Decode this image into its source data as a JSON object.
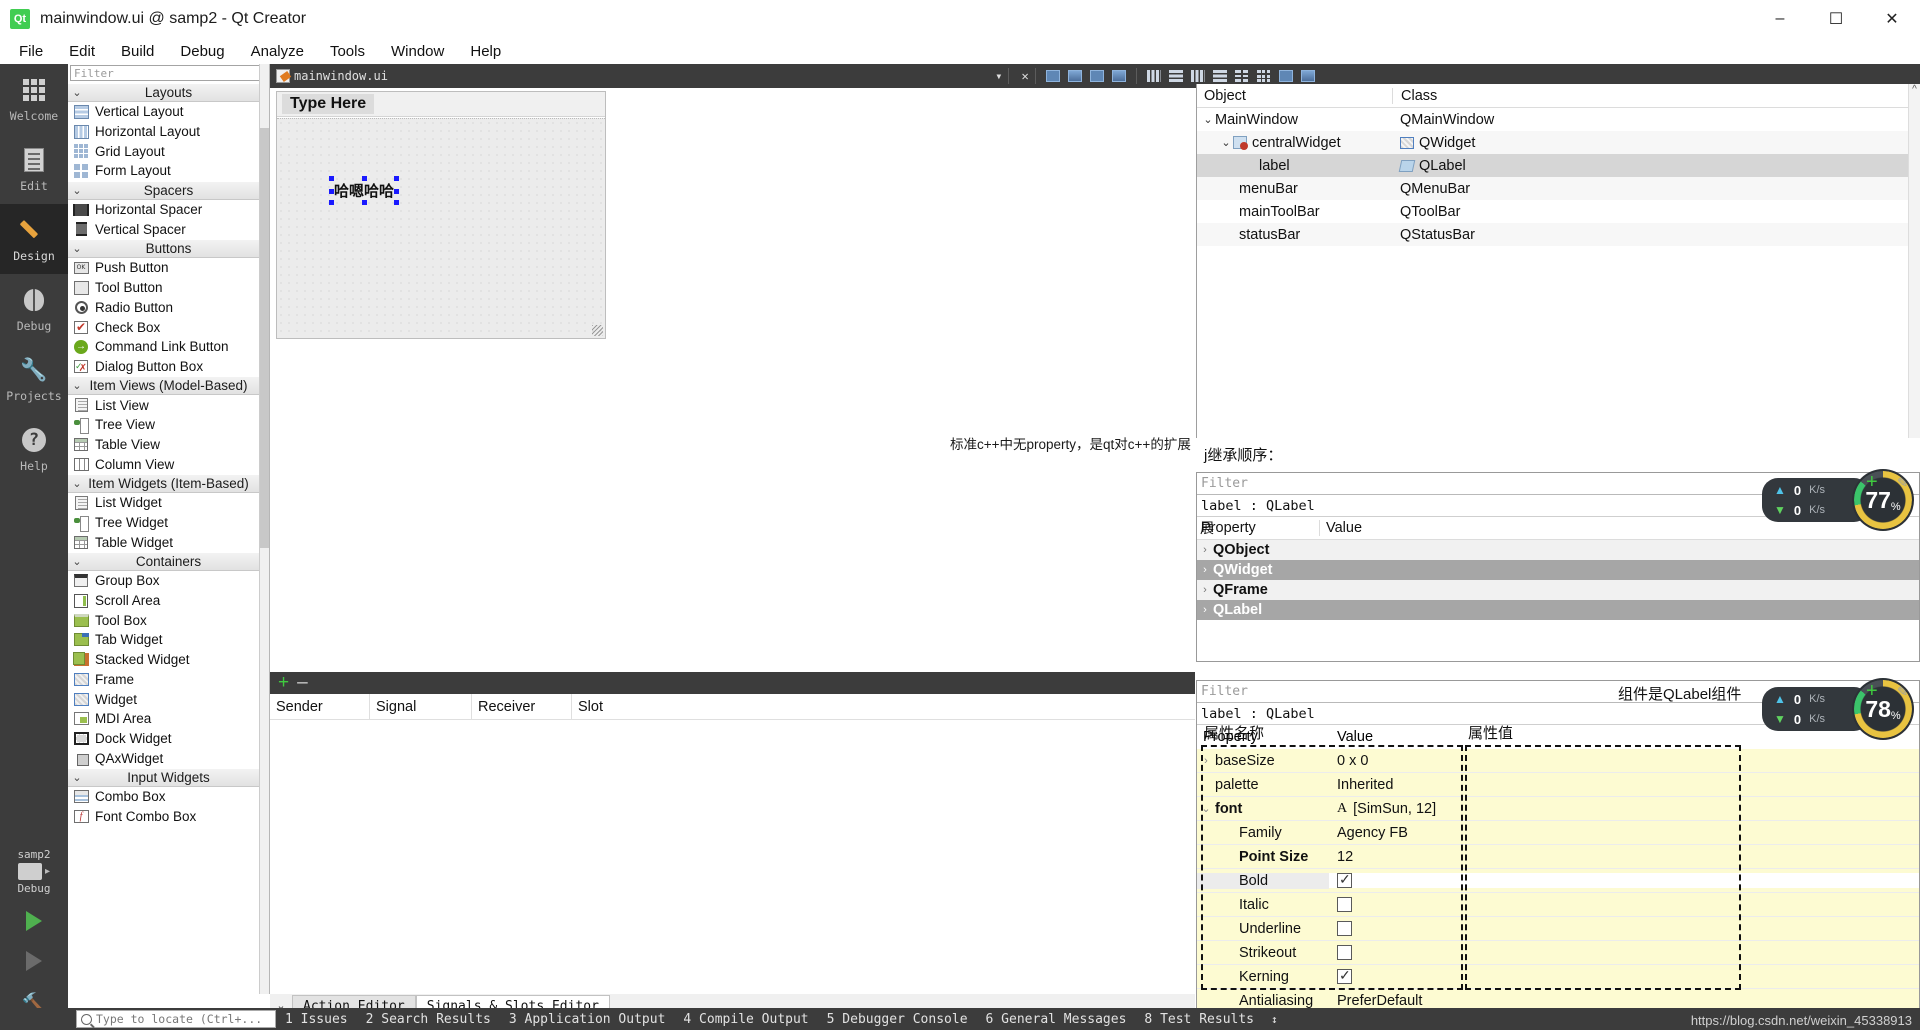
{
  "window": {
    "title": "mainwindow.ui @ samp2 - Qt Creator",
    "logo_text": "Qt",
    "minimize": "–",
    "maximize": "☐",
    "close": "✕"
  },
  "menubar": [
    {
      "label": "File"
    },
    {
      "label": "Edit"
    },
    {
      "label": "Build"
    },
    {
      "label": "Debug"
    },
    {
      "label": "Analyze"
    },
    {
      "label": "Tools"
    },
    {
      "label": "Window"
    },
    {
      "label": "Help"
    }
  ],
  "modebar": {
    "items": [
      {
        "label": "Welcome",
        "icon": "grid-icon"
      },
      {
        "label": "Edit",
        "icon": "document-icon"
      },
      {
        "label": "Design",
        "icon": "pencil-icon"
      },
      {
        "label": "Debug",
        "icon": "bug-icon"
      },
      {
        "label": "Projects",
        "icon": "wrench-icon"
      },
      {
        "label": "Help",
        "icon": "question-icon"
      }
    ],
    "kit_name": "samp2",
    "kit_mode": "Debug"
  },
  "editor_toolbar": {
    "file_name": "mainwindow.ui",
    "dropdown": "▾",
    "close": "✕"
  },
  "widget_box": {
    "filter_placeholder": "Filter",
    "categories": [
      {
        "name": "Layouts",
        "items": [
          {
            "label": "Vertical Layout",
            "icon": "vertical-layout-icon"
          },
          {
            "label": "Horizontal Layout",
            "icon": "horizontal-layout-icon"
          },
          {
            "label": "Grid Layout",
            "icon": "grid-layout-icon"
          },
          {
            "label": "Form Layout",
            "icon": "form-layout-icon"
          }
        ]
      },
      {
        "name": "Spacers",
        "items": [
          {
            "label": "Horizontal Spacer",
            "icon": "horizontal-spacer-icon"
          },
          {
            "label": "Vertical Spacer",
            "icon": "vertical-spacer-icon"
          }
        ]
      },
      {
        "name": "Buttons",
        "items": [
          {
            "label": "Push Button",
            "icon": "push-button-icon"
          },
          {
            "label": "Tool Button",
            "icon": "tool-button-icon"
          },
          {
            "label": "Radio Button",
            "icon": "radio-button-icon"
          },
          {
            "label": "Check Box",
            "icon": "check-box-icon"
          },
          {
            "label": "Command Link Button",
            "icon": "command-link-icon"
          },
          {
            "label": "Dialog Button Box",
            "icon": "dialog-button-box-icon"
          }
        ]
      },
      {
        "name": "Item Views (Model-Based)",
        "items": [
          {
            "label": "List View",
            "icon": "list-view-icon"
          },
          {
            "label": "Tree View",
            "icon": "tree-view-icon"
          },
          {
            "label": "Table View",
            "icon": "table-view-icon"
          },
          {
            "label": "Column View",
            "icon": "column-view-icon"
          }
        ]
      },
      {
        "name": "Item Widgets (Item-Based)",
        "items": [
          {
            "label": "List Widget",
            "icon": "list-widget-icon"
          },
          {
            "label": "Tree Widget",
            "icon": "tree-widget-icon"
          },
          {
            "label": "Table Widget",
            "icon": "table-widget-icon"
          }
        ]
      },
      {
        "name": "Containers",
        "items": [
          {
            "label": "Group Box",
            "icon": "group-box-icon"
          },
          {
            "label": "Scroll Area",
            "icon": "scroll-area-icon"
          },
          {
            "label": "Tool Box",
            "icon": "tool-box-icon"
          },
          {
            "label": "Tab Widget",
            "icon": "tab-widget-icon"
          },
          {
            "label": "Stacked Widget",
            "icon": "stacked-widget-icon"
          },
          {
            "label": "Frame",
            "icon": "frame-icon"
          },
          {
            "label": "Widget",
            "icon": "widget-icon"
          },
          {
            "label": "MDI Area",
            "icon": "mdi-area-icon"
          },
          {
            "label": "Dock Widget",
            "icon": "dock-widget-icon"
          },
          {
            "label": "QAxWidget",
            "icon": "qax-widget-icon"
          }
        ]
      },
      {
        "name": "Input Widgets",
        "items": [
          {
            "label": "Combo Box",
            "icon": "combo-box-icon"
          },
          {
            "label": "Font Combo Box",
            "icon": "font-combo-box-icon"
          }
        ]
      }
    ]
  },
  "canvas": {
    "type_here": "Type Here",
    "label_text": "哈嗯哈哈",
    "annotation": "标准c++中无property，是qt对c++的扩展"
  },
  "object_tree": {
    "columns": [
      "Object",
      "Class"
    ],
    "rows": [
      {
        "object": "MainWindow",
        "class": "QMainWindow",
        "indent": 0,
        "chevron": "⌄",
        "icon": "",
        "selected": false
      },
      {
        "object": "centralWidget",
        "class": "QWidget",
        "indent": 1,
        "chevron": "⌄",
        "icon": "central-widget-icon",
        "class_icon": "widget-icon",
        "selected": false
      },
      {
        "object": "label",
        "class": "QLabel",
        "indent": 2,
        "chevron": "",
        "icon": "",
        "class_icon": "label-icon",
        "selected": true
      },
      {
        "object": "menuBar",
        "class": "QMenuBar",
        "indent": 1,
        "chevron": "",
        "icon": "",
        "selected": false
      },
      {
        "object": "mainToolBar",
        "class": "QToolBar",
        "indent": 1,
        "chevron": "",
        "icon": "",
        "selected": false
      },
      {
        "object": "statusBar",
        "class": "QStatusBar",
        "indent": 1,
        "chevron": "",
        "icon": "",
        "selected": false
      }
    ]
  },
  "inheritance_note": "j继承顺序：",
  "expand_note": "展",
  "property_editor_upper": {
    "filter_placeholder": "Filter",
    "object_line": "label : QLabel",
    "columns": [
      "Property",
      "Value"
    ],
    "rows": [
      {
        "name": "QObject",
        "style": "light"
      },
      {
        "name": "QWidget",
        "style": "dark"
      },
      {
        "name": "QFrame",
        "style": "light"
      },
      {
        "name": "QLabel",
        "style": "dark"
      }
    ]
  },
  "property_editor_lower": {
    "filter_placeholder": "Filter",
    "object_line": "label : QLabel",
    "note": "组件是QLabel组件",
    "col_note_name": "属性名称",
    "col_note_value": "属性值",
    "columns": [
      "Property",
      "Value"
    ],
    "rows": [
      {
        "name": "baseSize",
        "value": "0 x 0",
        "kind": "text",
        "chevron": "›",
        "indent": 1,
        "bold": false
      },
      {
        "name": "palette",
        "value": "Inherited",
        "kind": "text",
        "chevron": "",
        "indent": 1,
        "bold": false
      },
      {
        "name": "font",
        "value": "[SimSun, 12]",
        "kind": "font",
        "chevron": "⌄",
        "indent": 1,
        "bold": true
      },
      {
        "name": "Family",
        "value": "Agency FB",
        "kind": "text",
        "chevron": "",
        "indent": 2,
        "bold": false
      },
      {
        "name": "Point Size",
        "value": "12",
        "kind": "text",
        "chevron": "",
        "indent": 2,
        "bold": true
      },
      {
        "name": "Bold",
        "value": "checked",
        "kind": "checkbox",
        "chevron": "",
        "indent": 2,
        "bold": false
      },
      {
        "name": "Italic",
        "value": "unchecked",
        "kind": "checkbox",
        "chevron": "",
        "indent": 2,
        "bold": false
      },
      {
        "name": "Underline",
        "value": "unchecked",
        "kind": "checkbox",
        "chevron": "",
        "indent": 2,
        "bold": false
      },
      {
        "name": "Strikeout",
        "value": "unchecked",
        "kind": "checkbox",
        "chevron": "",
        "indent": 2,
        "bold": false
      },
      {
        "name": "Kerning",
        "value": "checked",
        "kind": "checkbox",
        "chevron": "",
        "indent": 2,
        "bold": false
      },
      {
        "name": "Antialiasing",
        "value": "PreferDefault",
        "kind": "text",
        "chevron": "",
        "indent": 2,
        "bold": false
      }
    ]
  },
  "signals_slots": {
    "add": "+",
    "remove": "–",
    "columns": [
      "Sender",
      "Signal",
      "Receiver",
      "Slot"
    ]
  },
  "editor_tabs": {
    "chevron": "⌄",
    "tabs": [
      {
        "label": "Action Editor",
        "active": false
      },
      {
        "label": "Signals & Slots Editor",
        "active": true
      }
    ]
  },
  "statusbar": {
    "locator_placeholder": "Type to locate (Ctrl+...",
    "items": [
      "1 Issues",
      "2 Search Results",
      "3 Application Output",
      "4 Compile Output",
      "5 Debugger Console",
      "6 General Messages",
      "8 Test Results"
    ],
    "updown": "↕",
    "watermark": "https://blog.csdn.net/weixin_45338913"
  },
  "speed_widgets": [
    {
      "up": "0",
      "down": "0",
      "unit": "K/s",
      "percent": "77",
      "pct_sign": "%"
    },
    {
      "up": "0",
      "down": "0",
      "unit": "K/s",
      "percent": "78",
      "pct_sign": "%"
    }
  ]
}
